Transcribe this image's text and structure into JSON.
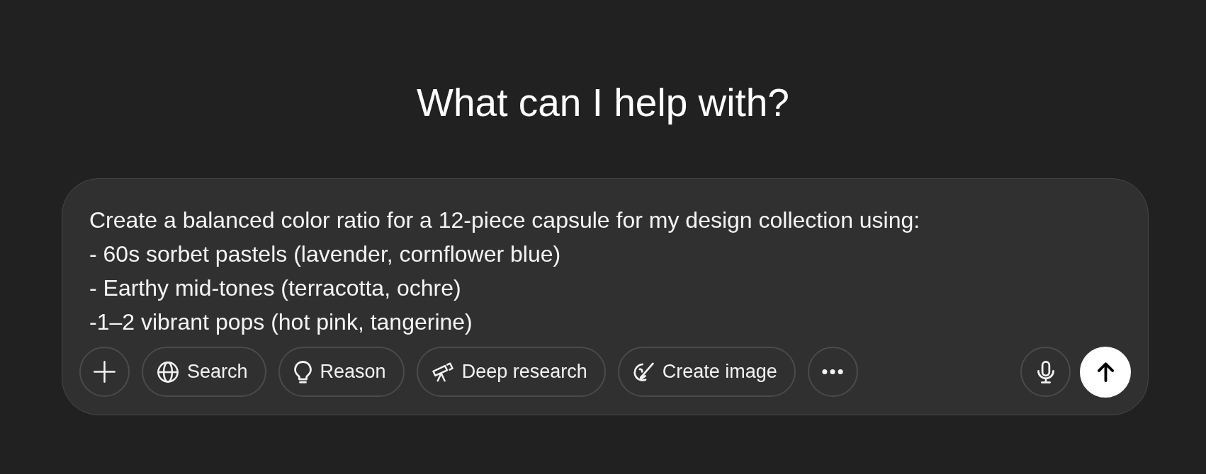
{
  "heading": "What can I help with?",
  "composer": {
    "value": "Create a balanced color ratio for a 12-piece capsule for my design collection using:\n- 60s sorbet pastels (lavender, cornflower blue)\n- Earthy mid-tones (terracotta, ochre)\n-1–2 vibrant pops (hot pink, tangerine)",
    "tools": [
      {
        "label": "Search",
        "selected": false
      },
      {
        "label": "Reason",
        "selected": false
      },
      {
        "label": "Deep research",
        "selected": false
      },
      {
        "label": "Create image",
        "selected": false
      }
    ],
    "send": {
      "disabled": false
    }
  }
}
